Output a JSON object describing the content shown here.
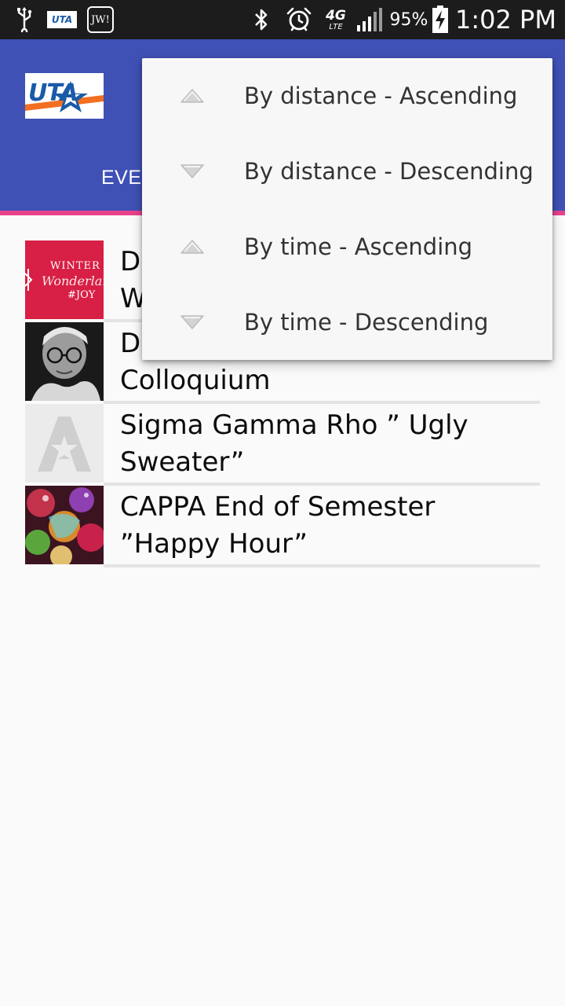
{
  "status_bar": {
    "battery_percent": "95%",
    "time": "1:02 PM",
    "network_label": "4G",
    "network_sub": "LTE",
    "app_icon_text": "JW!",
    "uta_icon_text": "UTA",
    "icons": [
      "usb-icon",
      "uta-notification-icon",
      "jw-app-icon",
      "bluetooth-icon",
      "alarm-icon",
      "lte-icon",
      "signal-icon",
      "battery-charging-icon"
    ]
  },
  "app_bar": {
    "logo_text": "UTA",
    "tab_label": "EVE",
    "background_color": "#3f51b5",
    "indicator_color": "#e8428b"
  },
  "events": [
    {
      "title": "Di\nW",
      "thumb_lines": [
        "WINTER",
        "Wonderland",
        "#JOY"
      ],
      "thumb_color": "#d81f45"
    },
    {
      "title": "De\nColloquium",
      "thumb_lines": [],
      "thumb_color": "#222222"
    },
    {
      "title": "Sigma Gamma Rho ” Ugly Sweater”",
      "thumb_lines": [],
      "thumb_color": "#ebebeb"
    },
    {
      "title": "CAPPA End of Semester ”Happy Hour”",
      "thumb_lines": [],
      "thumb_color": "#5a1a2c"
    }
  ],
  "sort_menu": {
    "items": [
      {
        "label": "By distance - Ascending",
        "direction": "up"
      },
      {
        "label": "By distance - Descending",
        "direction": "down"
      },
      {
        "label": "By time - Ascending",
        "direction": "up"
      },
      {
        "label": "By time - Descending",
        "direction": "down"
      }
    ]
  }
}
